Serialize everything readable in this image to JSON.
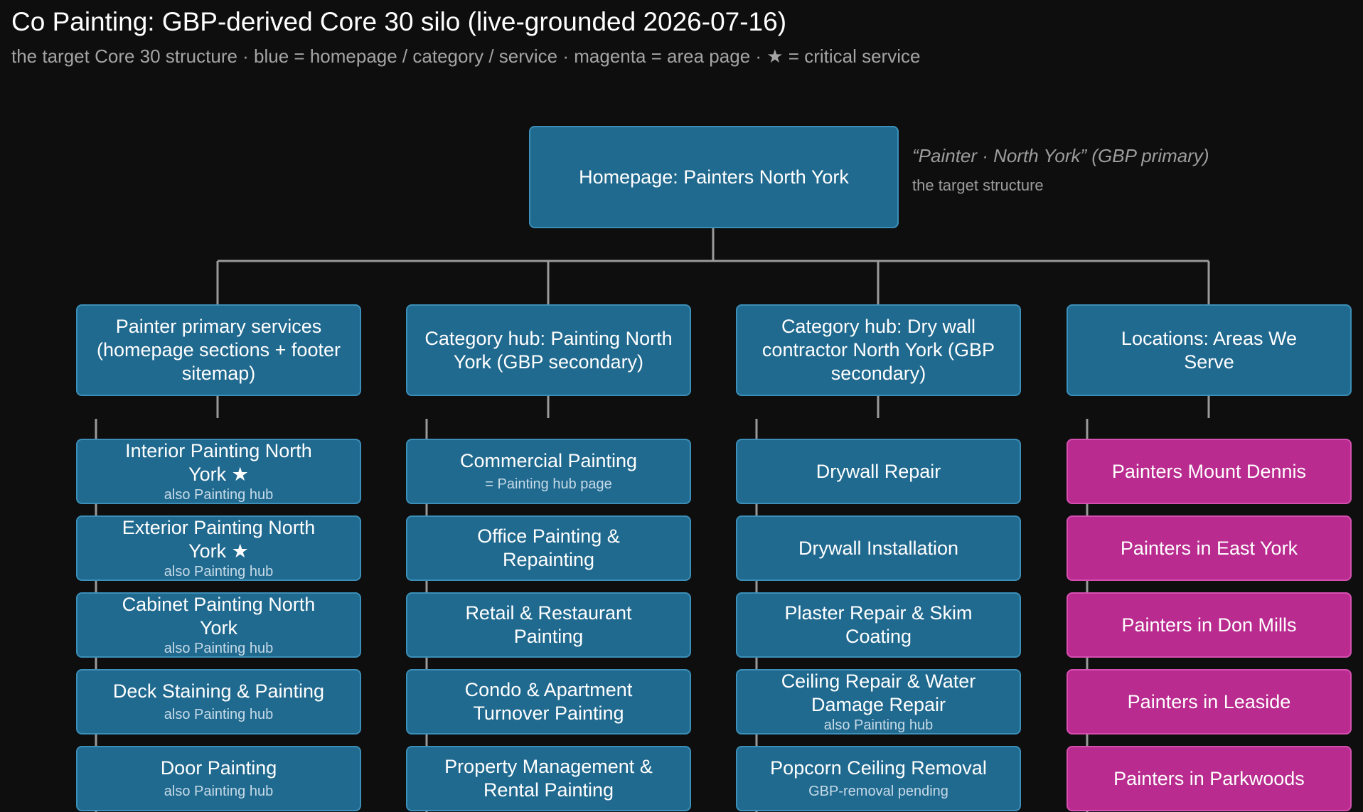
{
  "title": "Co Painting: GBP-derived Core 30 silo (live-grounded 2026-07-16)",
  "subtitle": "the target Core 30 structure · blue = homepage / category / service · magenta = area page · ★ = critical service",
  "root": {
    "label": "Homepage: Painters North York",
    "note": "“Painter · North York” (GBP primary)",
    "note_sub": "the target structure"
  },
  "hubs": [
    {
      "label": "Painter primary services (homepage sections + footer sitemap)"
    },
    {
      "label": "Category hub: Painting North York (GBP secondary)"
    },
    {
      "label": "Category hub: Dry wall contractor North York (GBP secondary)"
    },
    {
      "label": "Locations: Areas We Serve"
    }
  ],
  "columns": [
    {
      "items": [
        {
          "label": "Interior Painting North York ★",
          "sub": "also Painting hub"
        },
        {
          "label": "Exterior Painting North York ★",
          "sub": "also Painting hub"
        },
        {
          "label": "Cabinet Painting North York",
          "sub": "also Painting hub"
        },
        {
          "label": "Deck Staining & Painting",
          "sub": "also Painting hub"
        },
        {
          "label": "Door Painting",
          "sub": "also Painting hub"
        }
      ]
    },
    {
      "items": [
        {
          "label": "Commercial Painting",
          "sub": "= Painting hub page"
        },
        {
          "label": "Office Painting & Repainting",
          "sub": ""
        },
        {
          "label": "Retail & Restaurant Painting",
          "sub": ""
        },
        {
          "label": "Condo & Apartment Turnover Painting",
          "sub": ""
        },
        {
          "label": "Property Management & Rental Painting",
          "sub": ""
        }
      ]
    },
    {
      "items": [
        {
          "label": "Drywall Repair",
          "sub": ""
        },
        {
          "label": "Drywall Installation",
          "sub": ""
        },
        {
          "label": "Plaster Repair & Skim Coating",
          "sub": ""
        },
        {
          "label": "Ceiling Repair & Water Damage Repair",
          "sub": "also Painting hub"
        },
        {
          "label": "Popcorn Ceiling Removal",
          "sub": "GBP-removal pending"
        }
      ]
    },
    {
      "items": [
        {
          "label": "Painters Mount Dennis",
          "sub": ""
        },
        {
          "label": "Painters in East York",
          "sub": ""
        },
        {
          "label": "Painters in Don Mills",
          "sub": ""
        },
        {
          "label": "Painters in Leaside",
          "sub": ""
        },
        {
          "label": "Painters in Parkwoods",
          "sub": ""
        }
      ]
    }
  ],
  "colors": {
    "background": "#0e0e0f",
    "service_box": "#20698f",
    "area_box": "#b92b8f",
    "connector": "#9a9a9a"
  }
}
